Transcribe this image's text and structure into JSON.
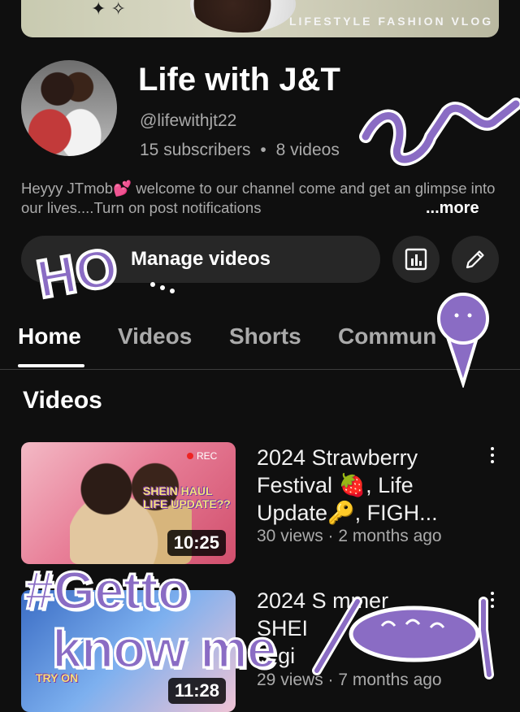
{
  "banner": {
    "text": "LIFESTYLE FASHION VLOG"
  },
  "channel": {
    "title": "Life with J&T",
    "handle": "@lifewithjt22",
    "subscribers": "15 subscribers",
    "separator": "•",
    "videos_count": "8 videos",
    "description": "Heyyy JTmob💕 welcome to our channel come and get an glimpse into our lives....Turn on post notifications",
    "more_label": "...more"
  },
  "actions": {
    "manage_videos": "Manage videos"
  },
  "tabs": [
    {
      "label": "Home",
      "active": true
    },
    {
      "label": "Videos",
      "active": false
    },
    {
      "label": "Shorts",
      "active": false
    },
    {
      "label": "Commun",
      "active": false
    }
  ],
  "section": {
    "title": "Videos"
  },
  "videos": [
    {
      "title_lines": [
        "2024 Strawberry",
        "Festival 🍓, Life",
        "Update🔑, FIGH..."
      ],
      "meta": "30 views · 2 months ago",
      "duration": "10:25",
      "thumb_rec": "REC",
      "thumb_text": "SHEIN HAUL LIFE UPDATE??"
    },
    {
      "title_lines": [
        "2024 S mmer",
        "SHEI",
        "'s gi"
      ],
      "meta": "29 views · 7 months ago",
      "duration": "11:28",
      "thumb_text": "TRY ON"
    }
  ],
  "stickers": {
    "ho": "HO",
    "getto": "#Getto",
    "knowme": "know me"
  },
  "colors": {
    "background": "#0f0f0f",
    "surface": "#272727",
    "secondary_text": "#aaaaaa",
    "sticker_purple": "#8a6cc4"
  }
}
